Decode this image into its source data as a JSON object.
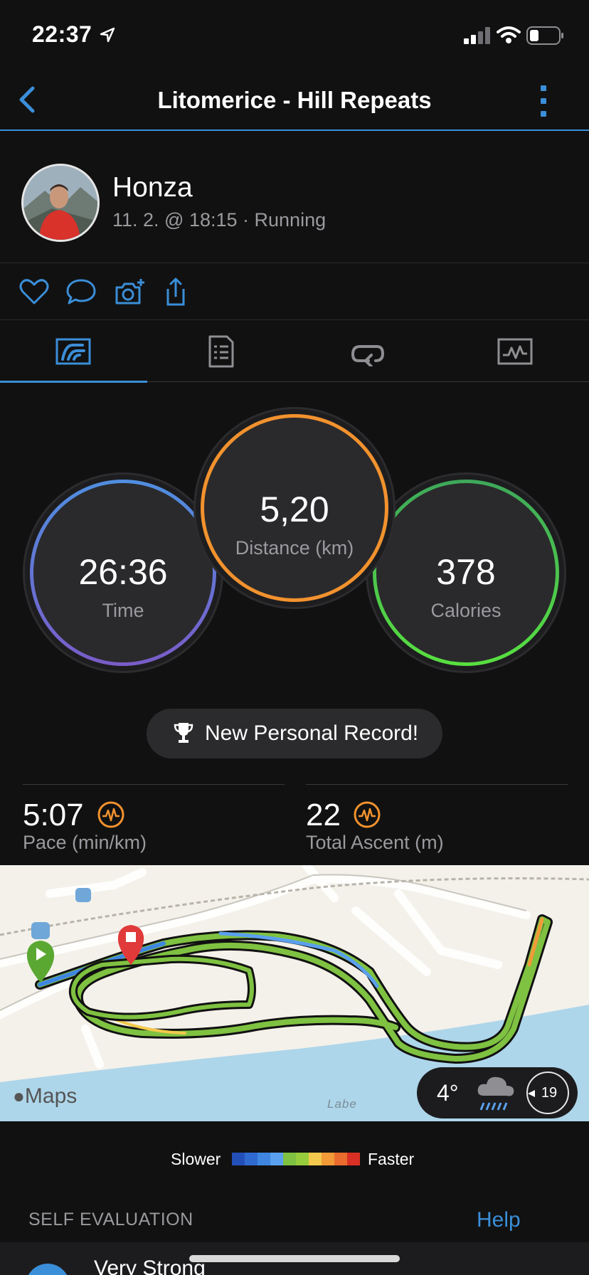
{
  "status": {
    "time": "22:37"
  },
  "nav": {
    "title": "Litomerice - Hill Repeats"
  },
  "user": {
    "name": "Honza",
    "meta": "11. 2. @ 18:15 · Running"
  },
  "stats": {
    "time": {
      "value": "26:36",
      "label": "Time"
    },
    "distance": {
      "value": "5,20",
      "label": "Distance (km)"
    },
    "calories": {
      "value": "378",
      "label": "Calories"
    }
  },
  "personal_record": "New Personal Record!",
  "pace": {
    "value": "5:07",
    "label": "Pace (min/km)"
  },
  "ascent": {
    "value": "22",
    "label": "Total Ascent (m)"
  },
  "map": {
    "brand": "Maps",
    "river_label": "Labe",
    "weather": {
      "temp": "4°",
      "wind": "19"
    }
  },
  "legend": {
    "slower": "Slower",
    "faster": "Faster",
    "colors": [
      "#2350b8",
      "#2f6ad0",
      "#3f86e0",
      "#5aa0ee",
      "#7fc141",
      "#97cc3c",
      "#f2c94c",
      "#f29a38",
      "#ea6b2e",
      "#d93025"
    ]
  },
  "self_evaluation": {
    "title": "SELF EVALUATION",
    "help": "Help",
    "value": "Very Strong"
  },
  "colors": {
    "accent": "#3b8ed8",
    "time_ring": "#5b8fe0",
    "distance_ring": "#f2922e",
    "calories_ring": "#4cd04a"
  }
}
